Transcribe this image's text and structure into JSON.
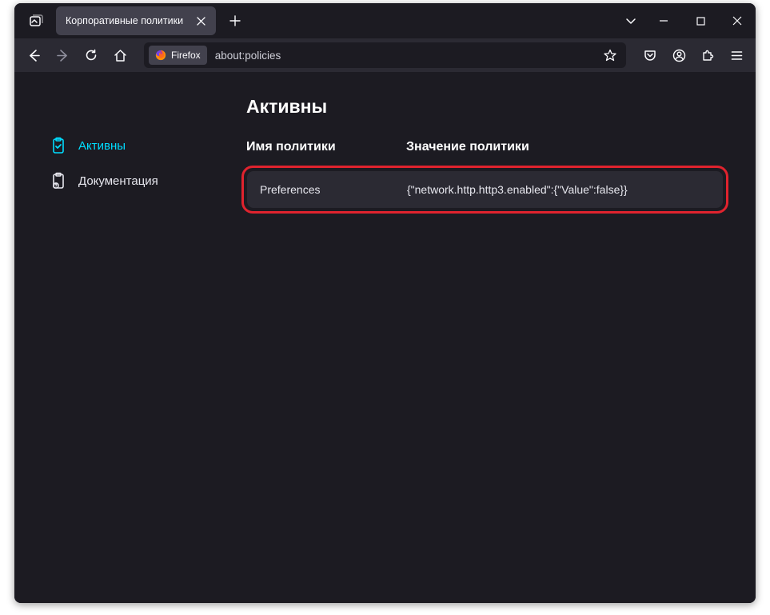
{
  "tab": {
    "title": "Корпоративные политики"
  },
  "urlbar": {
    "identity_label": "Firefox",
    "url": "about:policies"
  },
  "sidebar": {
    "active": "Активны",
    "docs": "Документация"
  },
  "page": {
    "heading": "Активны",
    "col_name": "Имя политики",
    "col_value": "Значение политики",
    "policies": [
      {
        "name": "Preferences",
        "value": "{\"network.http.http3.enabled\":{\"Value\":false}}"
      }
    ]
  }
}
